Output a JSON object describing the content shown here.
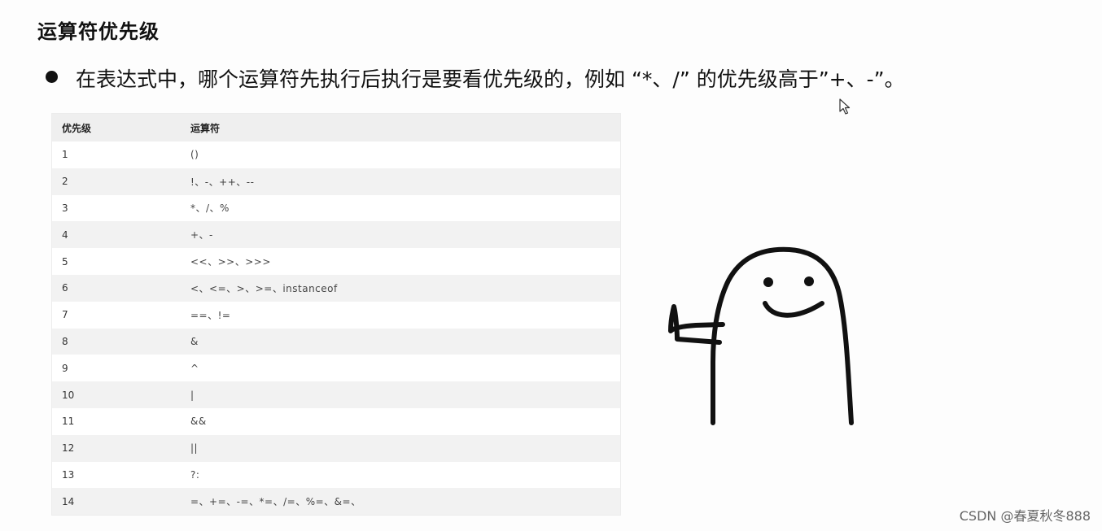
{
  "heading": "运算符优先级",
  "bullet_text": "在表达式中，哪个运算符先执行后执行是要看优先级的，例如 “*、/” 的优先级高于”+、-”。",
  "table": {
    "headers": [
      "优先级",
      "运算符"
    ],
    "rows": [
      [
        "1",
        "()"
      ],
      [
        "2",
        "!、-、++、--"
      ],
      [
        "3",
        "*、/、%"
      ],
      [
        "4",
        "+、-"
      ],
      [
        "5",
        "<<、>>、>>>"
      ],
      [
        "6",
        "<、<=、>、>=、instanceof"
      ],
      [
        "7",
        "==、!="
      ],
      [
        "8",
        "&"
      ],
      [
        "9",
        "^"
      ],
      [
        "10",
        "|"
      ],
      [
        "11",
        "&&"
      ],
      [
        "12",
        "||"
      ],
      [
        "13",
        "?:"
      ],
      [
        "14",
        "=、+=、-=、*=、/=、%=、&=、"
      ]
    ]
  },
  "watermark": "CSDN @春夏秋冬888",
  "icons": {
    "bullet": "bullet-dot-icon",
    "cursor": "mouse-pointer-icon",
    "illustration": "smiling-blob-waving-icon"
  }
}
